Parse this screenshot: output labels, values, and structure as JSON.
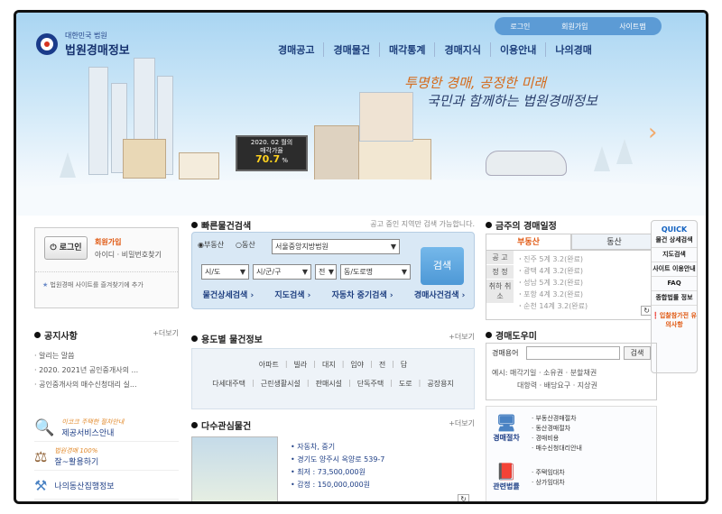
{
  "header": {
    "logo_sub": "대한민국 법원",
    "logo_title": "법원경매정보",
    "util": [
      "로그인",
      "회원가입",
      "사이트맵"
    ],
    "gnb": [
      "경매공고",
      "경매물건",
      "매각통계",
      "경매지식",
      "이용안내",
      "나의경매"
    ]
  },
  "hero": {
    "slogan1": "투명한 경매, 공정한 미래",
    "slogan2": "국민과 함께하는 법원경매정보",
    "sign_date": "2020. 02 월의",
    "sign_label": "매각가율",
    "sign_rate": "70.7",
    "sign_unit": "%"
  },
  "login": {
    "button": "로그인",
    "join": "회원가입",
    "find": "아이디 · 비밀번호찾기",
    "fav": "법원경매 사이트를 즐겨찾기에 추가"
  },
  "quick_search": {
    "title": "빠른물건검색",
    "note": "공고 중인 지역만 검색 가능합니다.",
    "radio1": "부동산",
    "radio2": "동산",
    "court": "서울중앙지방법원",
    "sido": "시/도",
    "sigungu": "시/군/구",
    "jeon": "전",
    "dong": "동/도로명",
    "search_button": "검색",
    "tabs": [
      "물건상세검색",
      "지도검색",
      "자동차 중기검색",
      "경매사건검색"
    ]
  },
  "week": {
    "title": "금주의 경매일정",
    "tab_on": "부동산",
    "tab_off": "동산",
    "side": [
      "공 고",
      "정 정",
      "취하 취소"
    ],
    "rows": [
      {
        "court": "진주 5계",
        "date": "3.2",
        "status": "(완료)"
      },
      {
        "court": "광택 4계",
        "date": "3.2",
        "status": "(완료)"
      },
      {
        "court": "성남 5계",
        "date": "3.2",
        "status": "(완료)"
      },
      {
        "court": "포항 4계",
        "date": "3.2",
        "status": "(완료)"
      },
      {
        "court": "순천 14계",
        "date": "3.2",
        "status": "(완료)"
      }
    ]
  },
  "quick": {
    "title": "QUICK",
    "items": [
      "물건 상세검색",
      "지도검색",
      "사이트 이용안내",
      "FAQ",
      "종합법률 정보"
    ],
    "guide": "입찰참가전 유의사항"
  },
  "notice": {
    "title": "공지사항",
    "more": "+더보기",
    "items": [
      "알리는 말씀",
      "2020. 2021년 공인중개사의 ...",
      "공인중개사의 매수신청대리 실..."
    ]
  },
  "use": {
    "title": "용도별 물건정보",
    "more": "+더보기",
    "row1": [
      "아파트",
      "빌라",
      "대지",
      "임야",
      "전",
      "답"
    ],
    "row2": [
      "다세대주택",
      "근린생활시설",
      "판매시설",
      "단독주택",
      "도로",
      "공장용지"
    ]
  },
  "guide": {
    "title": "경매도우미",
    "label": "경매용어",
    "button": "검색",
    "ex1": "예시: 매각기일 · 소유권 · 분할채권",
    "ex2": "대항력 · 배당요구 · 지상권"
  },
  "interest": {
    "title": "다수관심물건",
    "more": "+더보기",
    "type": "자동차, 중기",
    "addr": "경기도 양주시 옥양로 539-7",
    "min": "최저 : 73,500,000원",
    "appr": "감정 : 150,000,000원"
  },
  "promos": [
    {
      "sub": "이코크 주택한 절차안내",
      "label": "제공서비스안내"
    },
    {
      "sub": "법원경매 100%",
      "label": "잘~활용하기"
    },
    {
      "sub": "",
      "label": "나의동산집행정보"
    }
  ],
  "related": {
    "proc_label": "경매절차",
    "proc": [
      "부동산경매절차",
      "동산경매절차",
      "경매비용",
      "매수신청대리안내"
    ],
    "law_label": "관련법률",
    "law": [
      "주택임대차",
      "상가임대차"
    ]
  }
}
